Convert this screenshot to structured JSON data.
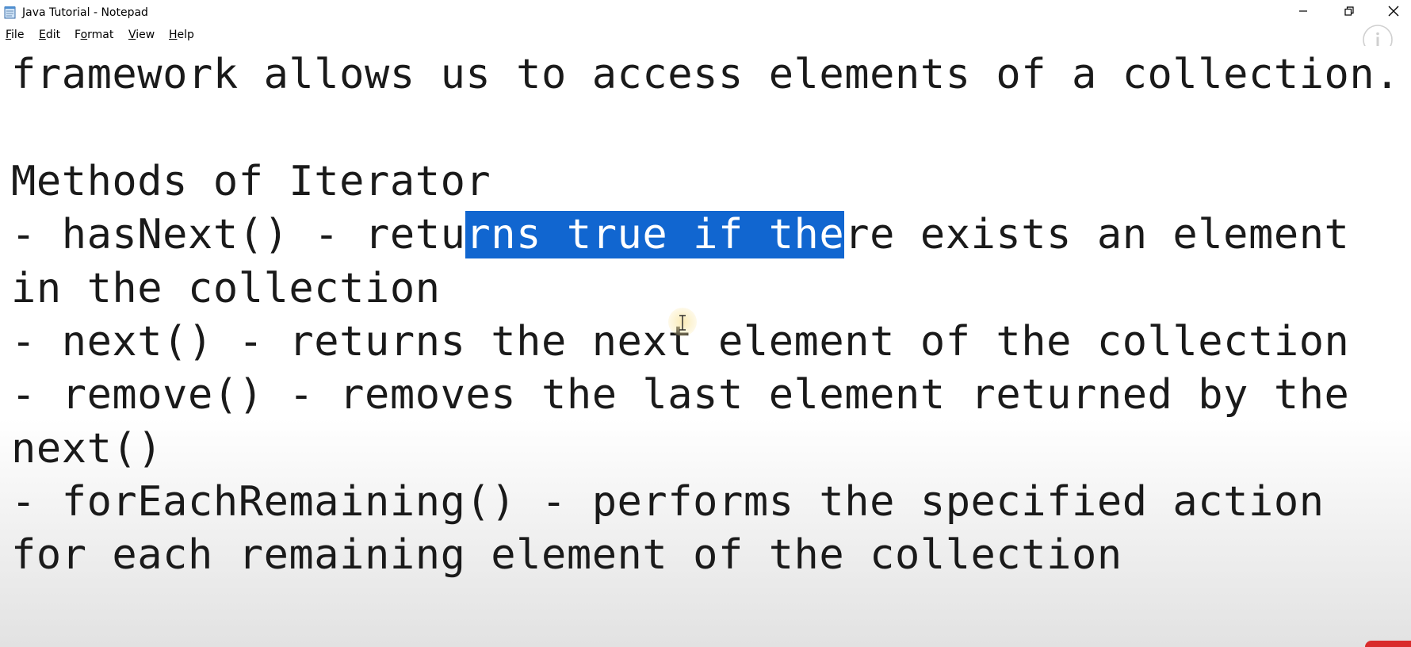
{
  "window": {
    "title": "Java Tutorial - Notepad"
  },
  "menu": {
    "file": {
      "underlined": "F",
      "rest": "ile"
    },
    "edit": {
      "underlined": "E",
      "rest": "dit"
    },
    "format": {
      "prefix": "F",
      "underlined": "o",
      "rest": "rmat"
    },
    "view": {
      "underlined": "V",
      "rest": "iew"
    },
    "help": {
      "underlined": "H",
      "rest": "elp"
    }
  },
  "editor": {
    "lines": [
      "framework allows us to access elements of a collection.",
      "",
      "Methods of Iterator",
      "- hasNext() - returns true if there exists an element",
      "in the collection",
      "- next() - returns the next element of the collection",
      "- remove() - removes the last element returned by the",
      "next()",
      "- forEachRemaining() - performs the specified action",
      "for each remaining element of the collection"
    ],
    "selection_line": {
      "before": "- hasNext() - retu",
      "selected": "rns true if the",
      "after": "re exists an element"
    }
  },
  "icons": {
    "app": "notepad-icon",
    "minimize": "minimize-icon",
    "maximize": "restore-icon",
    "close": "close-icon",
    "info": "info-icon",
    "cursor": "text-cursor-icon"
  },
  "colors": {
    "selection": "#1166d0",
    "text": "#1a1a1a"
  }
}
